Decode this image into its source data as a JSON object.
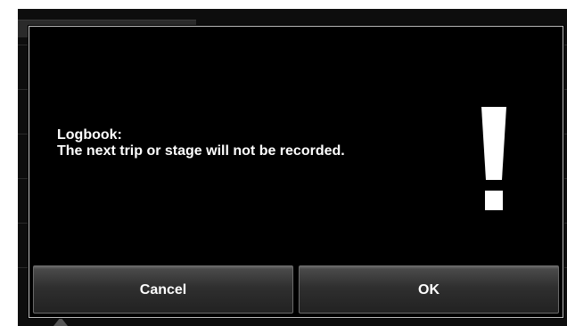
{
  "dialog": {
    "message_lines": [
      "Logbook:",
      "The next trip or stage will not be recorded."
    ],
    "icon": "exclamation-icon",
    "buttons": {
      "cancel_label": "Cancel",
      "ok_label": "OK"
    }
  },
  "colors": {
    "background": "#000000",
    "text": "#ffffff",
    "border": "#bdbdbd"
  }
}
